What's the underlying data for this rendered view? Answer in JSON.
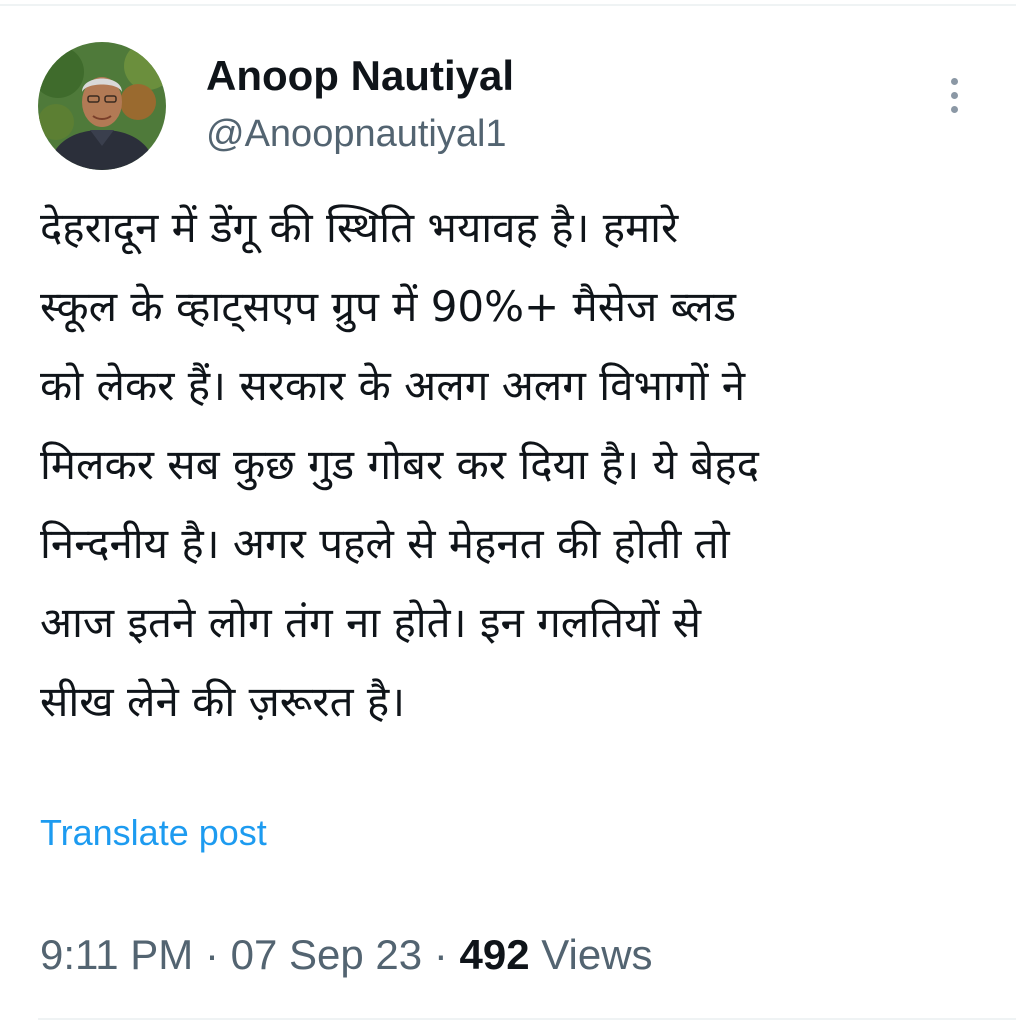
{
  "author": {
    "name": "Anoop Nautiyal",
    "handle": "@Anoopnautiyal1"
  },
  "post": {
    "lines": [
      "देहरादून में डेंगू की स्थिति भयावह है। हमारे",
      "स्कूल के व्हाट्सएप ग्रुप में 90%+ मैसेज ब्लड",
      "को लेकर हैं। सरकार के अलग अलग विभागों ने",
      "मिलकर सब कुछ गुड गोबर कर दिया है। ये बेहद",
      "निन्दनीय है। अगर पहले से मेहनत की होती तो",
      "आज इतने लोग तंग ना होते। इन गलतियों से",
      "सीख लेने की ज़रूरत है।"
    ],
    "translate_label": "Translate post"
  },
  "meta": {
    "time": "9:11 PM",
    "date": "07 Sep 23",
    "separator": "·",
    "views_count": "492",
    "views_label": "Views"
  },
  "icons": {
    "more": "vertical-ellipsis-icon",
    "avatar": "profile-photo"
  }
}
